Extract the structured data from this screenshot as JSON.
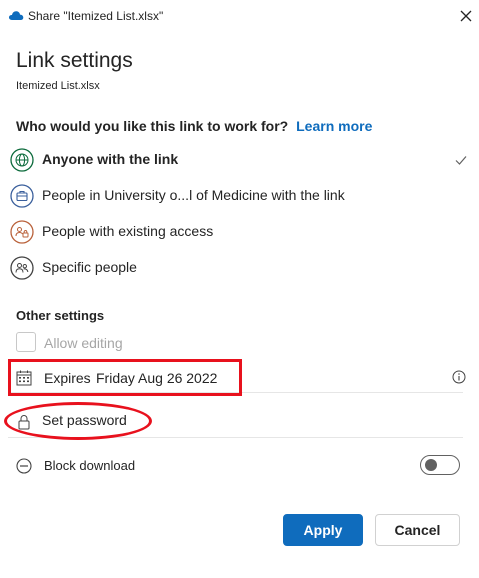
{
  "window": {
    "title": "Share \"Itemized List.xlsx\"",
    "icon": "onedrive-cloud-icon",
    "close_icon": "close-icon"
  },
  "header": {
    "title": "Link settings",
    "filename": "Itemized List.xlsx"
  },
  "audience": {
    "question": "Who would you like this link to work for?",
    "learn_more": "Learn more",
    "options": [
      {
        "label": "Anyone with the link",
        "icon": "globe-icon",
        "selected": true
      },
      {
        "label": "People in University o...l of Medicine with the link",
        "icon": "briefcase-icon",
        "selected": false
      },
      {
        "label": "People with existing access",
        "icon": "people-lock-icon",
        "selected": false
      },
      {
        "label": "Specific people",
        "icon": "people-icon",
        "selected": false
      }
    ]
  },
  "other_settings": {
    "title": "Other settings",
    "allow_editing": {
      "label": "Allow editing",
      "checked": false,
      "disabled": true
    },
    "expires": {
      "label": "Expires",
      "value": "Friday Aug 26 2022"
    },
    "password": {
      "label": "Set password"
    },
    "block_download": {
      "label": "Block download",
      "on": false
    }
  },
  "footer": {
    "apply": "Apply",
    "cancel": "Cancel"
  },
  "colors": {
    "accent": "#0f6cbd",
    "annotation": "#e8111d"
  }
}
